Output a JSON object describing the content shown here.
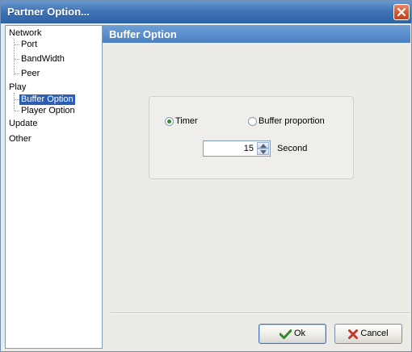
{
  "window": {
    "title": "Partner Option..."
  },
  "tree": {
    "network": {
      "label": "Network",
      "children": [
        "Port",
        "BandWidth",
        "Peer"
      ]
    },
    "play": {
      "label": "Play",
      "children": [
        "Buffer Option",
        "Player Option"
      ],
      "selected": "Buffer Option"
    },
    "update": {
      "label": "Update"
    },
    "other": {
      "label": "Other"
    }
  },
  "section": {
    "title": "Buffer Option"
  },
  "options": {
    "timer_label": "Timer",
    "buffer_proportion_label": "Buffer proportion",
    "selected": "Timer",
    "timer_value": "15",
    "unit_label": "Second"
  },
  "buttons": {
    "ok_label": "Ok",
    "cancel_label": "Cancel"
  },
  "colors": {
    "titlebar": "#3f74b6",
    "section_header": "#4a7fc1",
    "selection": "#2c5fb3",
    "ok_check": "#2f8a2f",
    "cancel_x": "#c0392b"
  }
}
